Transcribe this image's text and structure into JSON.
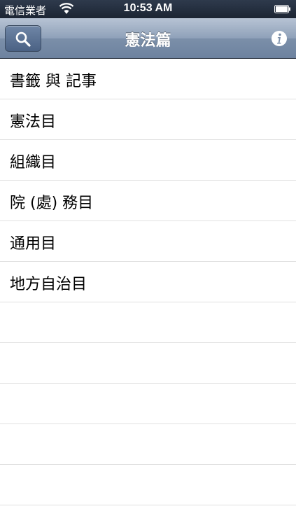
{
  "status_bar": {
    "carrier": "電信業者",
    "time": "10:53 AM"
  },
  "nav_bar": {
    "title": "憲法篇",
    "left_icon": "search-icon",
    "right_icon": "info-icon"
  },
  "menu": {
    "items": [
      {
        "label": "書籤 與 記事"
      },
      {
        "label": "憲法目"
      },
      {
        "label": "組織目"
      },
      {
        "label": "院 (處) 務目"
      },
      {
        "label": "通用目"
      },
      {
        "label": "地方自治目"
      }
    ]
  }
}
